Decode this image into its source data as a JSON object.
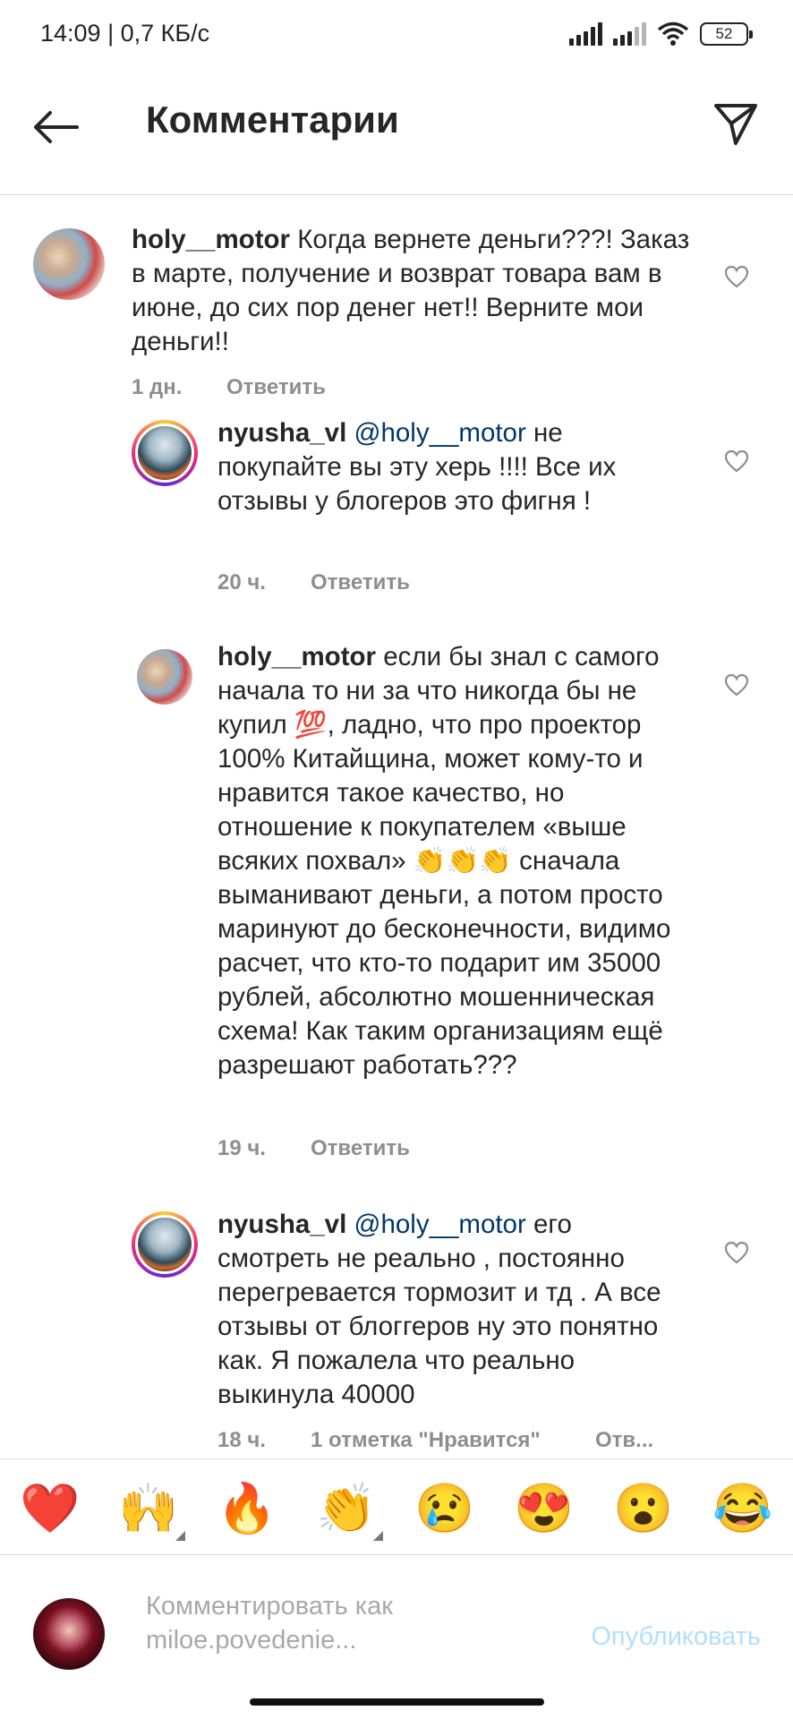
{
  "status_bar": {
    "time": "14:09 | 0,7 КБ/с",
    "battery": "52"
  },
  "header": {
    "title": "Комментарии",
    "back_icon": "arrow-left-icon",
    "send_icon": "paper-plane-icon"
  },
  "comments": [
    {
      "username": "holy__motor",
      "mention": "",
      "text": "Когда вернете деньги???! Заказ в марте, получение и возврат товара вам в июне, до сих пор денег нет!! Верните мои деньги!!",
      "time": "1 дн.",
      "likes": "",
      "reply": "Ответить"
    },
    {
      "username": "nyusha_vl",
      "mention": "@holy__motor",
      "text": "не покупайте вы эту херь !!!! Все их отзывы у блогеров это фигня !",
      "time": "20 ч.",
      "likes": "",
      "reply": "Ответить"
    },
    {
      "username": "holy__motor",
      "mention": "",
      "text": "если бы знал с самого начала то ни за что никогда бы не купил 💯, ладно, что про проектор 100% Китайщина, может кому-то и нравится такое качество, но отношение к покупателем «выше всяких похвал» 👏👏👏 сначала выманивают деньги, а потом просто маринуют до бесконечности, видимо расчет, что кто-то подарит им 35000 рублей, абсолютно мошенническая схема! Как таким организациям ещё разрешают работать???",
      "time": "19 ч.",
      "likes": "",
      "reply": "Ответить"
    },
    {
      "username": "nyusha_vl",
      "mention": "@holy__motor",
      "text": "его смотреть не реально , постоянно перегревается тормозит и тд . А все отзывы от блоггеров ну это понятно как. Я пожалела что реально выкинула 40000",
      "time": "18 ч.",
      "likes": "1 отметка \"Нравится\"",
      "reply": "Отв..."
    }
  ],
  "emoji_bar": [
    "❤️",
    "🙌",
    "🔥",
    "👏",
    "😢",
    "😍",
    "😮",
    "😂"
  ],
  "composer": {
    "placeholder": "Комментировать как miloe.povedenie...",
    "publish": "Опубликовать"
  },
  "colors": {
    "mention": "#00376b",
    "meta": "#8e8e8e",
    "publish_disabled": "#b2dffc"
  }
}
